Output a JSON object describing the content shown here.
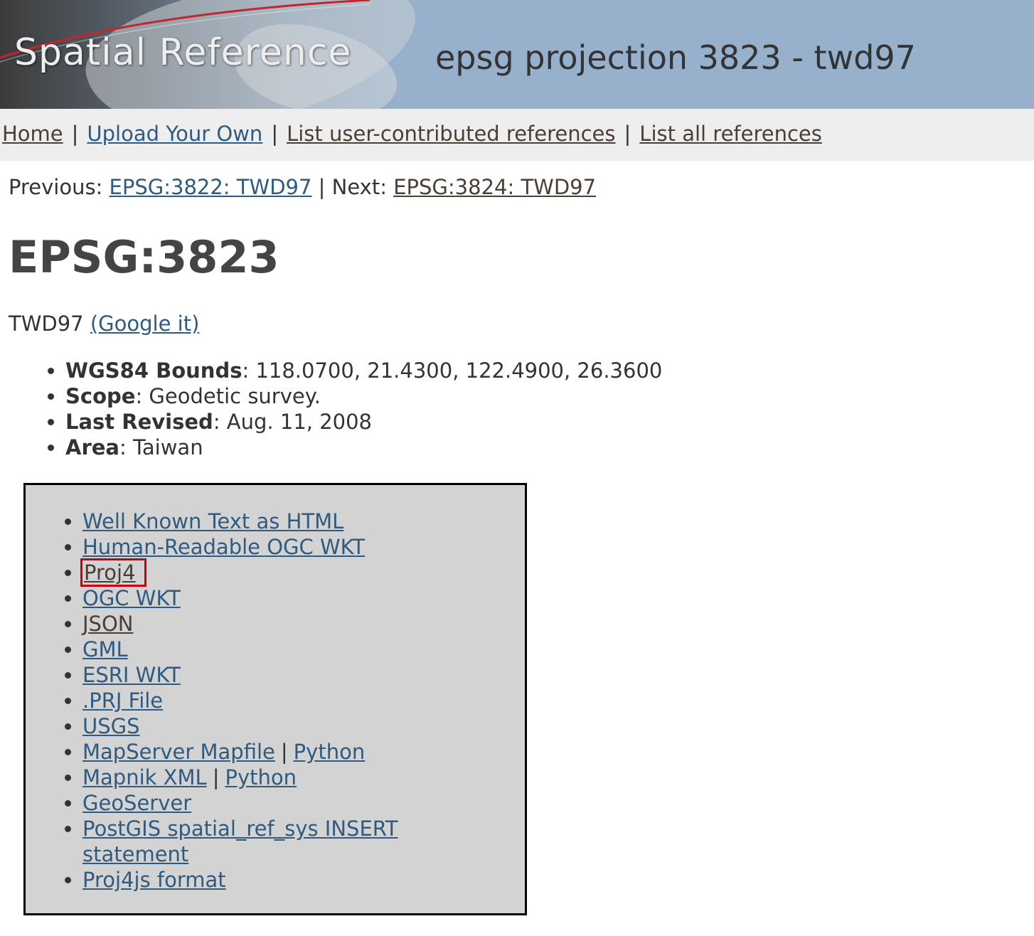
{
  "header": {
    "logo_text": "Spatial Reference",
    "page_title": "epsg projection 3823 - twd97"
  },
  "nav": {
    "items": [
      "Home",
      "Upload Your Own",
      "List user-contributed references",
      "List all references"
    ],
    "separator": "|"
  },
  "prevnext": {
    "prev_label": "Previous:",
    "prev_link": "EPSG:3822: TWD97",
    "sep": "|",
    "next_label": "Next:",
    "next_link": "EPSG:3824: TWD97"
  },
  "code": "EPSG:3823",
  "name": "TWD97",
  "google_link": "(Google it)",
  "properties": [
    {
      "label": "WGS84 Bounds",
      "value": ": 118.0700, 21.4300, 122.4900, 26.3600"
    },
    {
      "label": "Scope",
      "value": ": Geodetic survey."
    },
    {
      "label": "Last Revised",
      "value": ": Aug. 11, 2008"
    },
    {
      "label": "Area",
      "value": ": Taiwan"
    }
  ],
  "formats": {
    "wkt_html": "Well Known Text as HTML",
    "human_wkt": "Human-Readable OGC WKT",
    "proj4": "Proj4",
    "ogc_wkt": "OGC WKT",
    "json": "JSON",
    "gml": "GML",
    "esri_wkt": "ESRI WKT",
    "prj": ".PRJ File",
    "usgs": "USGS",
    "mapserver": "MapServer Mapfile",
    "mapserver_python": "Python",
    "mapnik": "Mapnik XML",
    "mapnik_python": "Python",
    "geoserver": "GeoServer",
    "postgis_line1": "PostGIS spatial_ref_sys INSERT",
    "postgis_line2": "statement",
    "proj4js": "Proj4js format",
    "pipe": "|"
  },
  "colors": {
    "link": "#2f5b80",
    "visited_link": "#4a3f35",
    "highlight_box": "#cc0000",
    "formats_bg": "#d3d3d3",
    "banner_bg": "#97b1cc"
  }
}
